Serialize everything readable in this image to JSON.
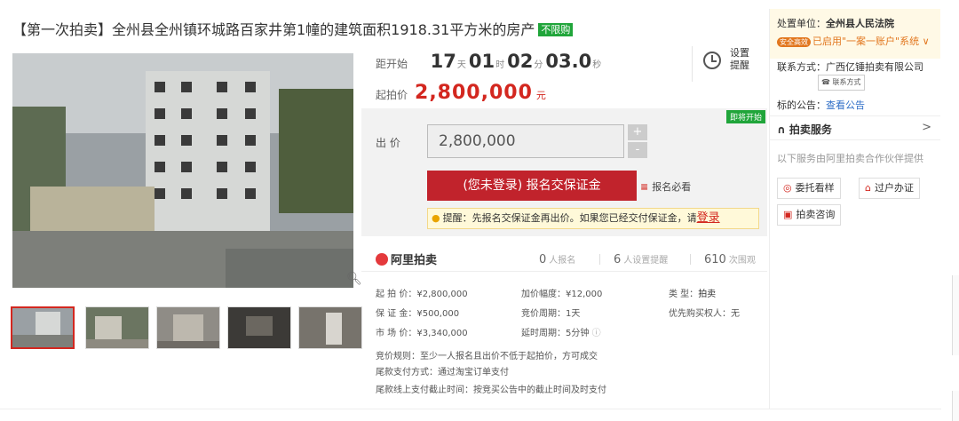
{
  "title": {
    "text": "【第一次拍卖】全州县全州镇环城路百家井第1幢的建筑面积1918.31平方米的房产",
    "tag": "不限购"
  },
  "countdown": {
    "label": "距开始",
    "days": "17",
    "days_unit": "天",
    "hours": "01",
    "hours_unit": "时",
    "minutes": "02",
    "minutes_unit": "分",
    "seconds": "03.0",
    "seconds_unit": "秒"
  },
  "remind": {
    "line1": "设置",
    "line2": "提醒"
  },
  "start_price": {
    "label": "起拍价",
    "value": "2,800,000",
    "unit": "元"
  },
  "bid": {
    "status_badge": "即将开始",
    "label": "出 价",
    "input_value": "2,800,000",
    "plus": "+",
    "minus": "-",
    "signup_button": "(您未登录) 报名交保证金",
    "must_read": "报名必看",
    "tip_text": "提醒：先报名交保证金再出价。如果您已经交付保证金，请",
    "tip_link": "登录"
  },
  "stats": {
    "logo": "阿里拍卖",
    "signups": "0",
    "signups_label": "人报名",
    "reminders": "6",
    "reminders_label": "人设置提醒",
    "views": "610",
    "views_label": "次围观"
  },
  "details": {
    "start_price": "起 拍 价：¥2,800,000",
    "deposit": "保 证 金：¥500,000",
    "market_price": "市 场 价：¥3,340,000",
    "increment": "加价幅度：¥12,000",
    "cycle": "竞价周期：1天",
    "delay": "延时周期：5分钟",
    "type_label": "类    型：",
    "type_value": "拍卖",
    "priority": "优先购买权人",
    "priority_value": "：无",
    "rule1": "竞价规则：至少一人报名且出价不低于起拍价，方可成交",
    "rule2": "尾款支付方式：通过淘宝订单支付",
    "rule3": "尾款线上支付截止时间：按竞买公告中的截止时间及时支付"
  },
  "right": {
    "court_label": "处置单位：",
    "court_name": "全州县人民法院",
    "safe_badge": "安全高效",
    "account_text": "已启用\"一案一账户\"系统",
    "contact_label": "联系方式：",
    "contact_value": "广西亿锤拍卖有限公司",
    "contact_button": "联系方式",
    "notice_label": "标的公告：",
    "notice_link": "查看公告",
    "service_title": "拍卖服务",
    "service_arrow": ">",
    "service_sub": "以下服务由阿里拍卖合作伙伴提供",
    "svc1": "委托看样",
    "svc2": "过户办证",
    "svc3": "拍卖咨询"
  },
  "colors": {
    "accent_red": "#d3271f",
    "button_red": "#c1232c",
    "green_tag": "#20a53a"
  }
}
